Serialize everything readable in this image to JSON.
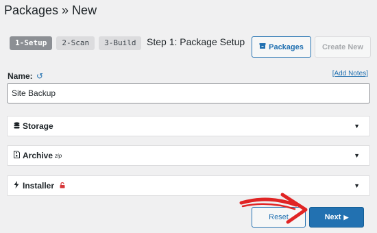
{
  "page": {
    "title": "Packages » New"
  },
  "steps": [
    {
      "label": "1-Setup",
      "active": true
    },
    {
      "label": "2-Scan",
      "active": false
    },
    {
      "label": "3-Build",
      "active": false
    }
  ],
  "step_title": "Step 1: Package Setup",
  "toolbar": {
    "packages_label": "Packages",
    "packages_icon": "archive-icon",
    "create_new_label": "Create New"
  },
  "name_section": {
    "label": "Name:",
    "reset_icon": "undo-icon",
    "add_notes_label": "[Add Notes]",
    "input_value": "Site Backup"
  },
  "panels": {
    "storage": {
      "label": "Storage",
      "icon": "database-icon"
    },
    "archive": {
      "label": "Archive",
      "suffix": "zip",
      "icon": "file-archive-icon"
    },
    "installer": {
      "label": "Installer",
      "icon": "bolt-icon",
      "lock_icon": "unlock-icon"
    }
  },
  "footer": {
    "reset_label": "Reset",
    "next_label": "Next"
  },
  "colors": {
    "accent": "#2271b1",
    "annotation_arrow": "#e02424",
    "lock": "#d63638"
  }
}
